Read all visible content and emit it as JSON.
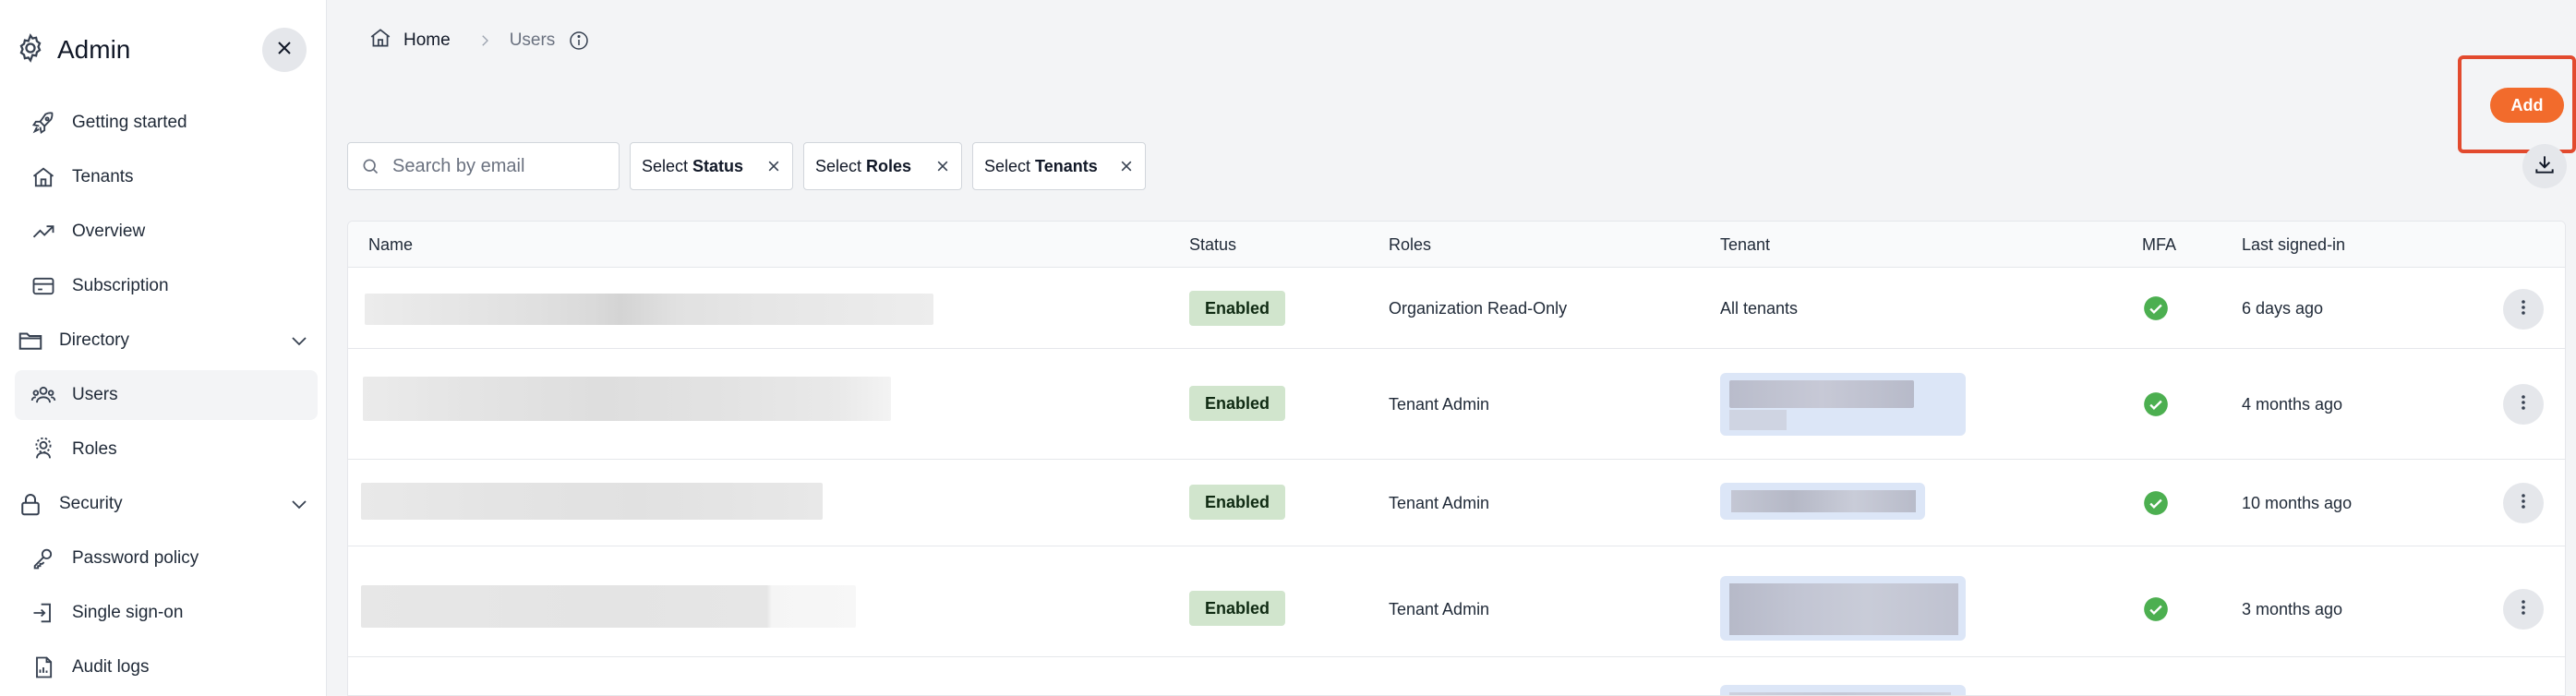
{
  "sidebar": {
    "title": "Admin",
    "items": [
      {
        "label": "Getting started",
        "icon": "rocket-icon"
      },
      {
        "label": "Tenants",
        "icon": "home-icon"
      },
      {
        "label": "Overview",
        "icon": "trending-up-icon"
      },
      {
        "label": "Subscription",
        "icon": "credit-card-icon"
      },
      {
        "label": "Directory",
        "icon": "folder-icon"
      },
      {
        "label": "Users",
        "icon": "users-icon"
      },
      {
        "label": "Roles",
        "icon": "roles-icon"
      },
      {
        "label": "Security",
        "icon": "lock-icon"
      },
      {
        "label": "Password policy",
        "icon": "key-icon"
      },
      {
        "label": "Single sign-on",
        "icon": "sign-in-icon"
      },
      {
        "label": "Audit logs",
        "icon": "report-icon"
      }
    ]
  },
  "breadcrumb": {
    "home": "Home",
    "current": "Users"
  },
  "actions": {
    "add": "Add"
  },
  "search": {
    "placeholder": "Search by email"
  },
  "filters": [
    {
      "prefix": "Select",
      "value": "Status"
    },
    {
      "prefix": "Select",
      "value": "Roles"
    },
    {
      "prefix": "Select",
      "value": "Tenants"
    }
  ],
  "table": {
    "headers": [
      "Name",
      "Status",
      "Roles",
      "Tenant",
      "MFA",
      "Last signed-in"
    ],
    "rows": [
      {
        "status": "Enabled",
        "role": "Organization Read-Only",
        "tenant": "All tenants",
        "last": "6 days ago"
      },
      {
        "status": "Enabled",
        "role": "Tenant Admin",
        "tenant": "",
        "last": "4 months ago"
      },
      {
        "status": "Enabled",
        "role": "Tenant Admin",
        "tenant": "",
        "last": "10 months ago"
      },
      {
        "status": "Enabled",
        "role": "Tenant Admin",
        "tenant": "",
        "last": "3 months ago"
      }
    ]
  },
  "colors": {
    "accent": "#f26b2c",
    "highlight": "#e24a2e",
    "badge": "#d1e5cd",
    "mfa": "#4caf50"
  }
}
